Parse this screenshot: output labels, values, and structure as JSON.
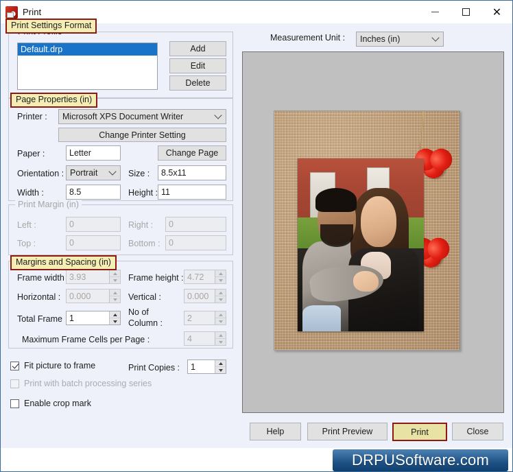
{
  "window": {
    "title": "Print",
    "icon": "app-icon",
    "controls": {
      "minimize": "—",
      "maximize": "□",
      "close": "✕"
    }
  },
  "tabs": {
    "print_settings_format": "Print Settings Format"
  },
  "print_profile": {
    "group_label": "Print Profile",
    "items": [
      {
        "name": "Default.drp",
        "selected": true
      }
    ],
    "buttons": {
      "add": "Add",
      "edit": "Edit",
      "delete": "Delete"
    }
  },
  "page_properties": {
    "group_label": "Page Properties  (in)",
    "printer_label": "Printer :",
    "printer_value": "Microsoft XPS Document Writer",
    "change_printer_setting": "Change Printer Setting",
    "paper_label": "Paper :",
    "paper_value": "Letter",
    "change_page": "Change Page",
    "orientation_label": "Orientation :",
    "orientation_value": "Portrait",
    "size_label": "Size :",
    "size_value": "8.5x11",
    "width_label": "Width :",
    "width_value": "8.5",
    "height_label": "Height :",
    "height_value": "11"
  },
  "print_margin": {
    "group_label": "Print Margin  (in)",
    "left_label": "Left :",
    "left_value": "0",
    "right_label": "Right :",
    "right_value": "0",
    "top_label": "Top :",
    "top_value": "0",
    "bottom_label": "Bottom :",
    "bottom_value": "0",
    "enabled": false
  },
  "margins_and_spacing": {
    "group_label": "Margins and Spacing  (in)",
    "frame_width_label": "Frame width",
    "frame_width_value": "3.93",
    "frame_height_label": "Frame height :",
    "frame_height_value": "4.72",
    "horizontal_label": "Horizontal :",
    "horizontal_value": "0.000",
    "vertical_label": "Vertical :",
    "vertical_value": "0.000",
    "total_frame_label": "Total Frame",
    "total_frame_value": "1",
    "no_of_column_label_line1": "No of",
    "no_of_column_label_line2": "Column :",
    "no_of_column_value": "2",
    "max_cells_label": "Maximum Frame Cells per Page :",
    "max_cells_value": "4"
  },
  "options": {
    "fit_picture_to_frame": "Fit picture to frame",
    "fit_picture_to_frame_checked": true,
    "print_copies_label": "Print Copies :",
    "print_copies_value": "1",
    "print_batch_series": "Print with batch processing series",
    "print_batch_series_checked": false,
    "print_batch_series_enabled": false,
    "enable_crop_mark": "Enable crop mark",
    "enable_crop_mark_checked": false
  },
  "preview": {
    "measurement_unit_label": "Measurement Unit :",
    "measurement_unit_value": "Inches (in)"
  },
  "bottom_buttons": {
    "help": "Help",
    "print_preview": "Print Preview",
    "print": "Print",
    "close": "Close"
  },
  "footer": {
    "watermark": "DRPUSoftware.com"
  },
  "colors": {
    "accent_tab_bg": "#f5eeb4",
    "accent_tab_border": "#8b1a12",
    "dialog_bg": "#eef1fa",
    "selection_blue": "#1973c8",
    "preview_bg": "#c0c0c0",
    "watermark_blue": "#1c5083"
  }
}
